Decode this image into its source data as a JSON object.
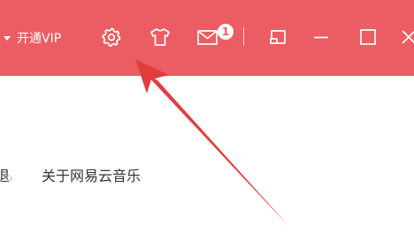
{
  "titlebar": {
    "background_color": "#ec5c63",
    "vip_label": "开通VIP",
    "icons": {
      "vip_dropdown": "caret-down-icon",
      "settings": "gear-icon",
      "skin": "tshirt-icon",
      "messages": "mail-icon",
      "mini_mode": "mini-player-icon",
      "minimize": "minimize-icon",
      "maximize": "maximize-icon",
      "close": "close-icon"
    },
    "message_count": "1"
  },
  "menu": {
    "left_item_label": "退出",
    "about_label": "关于网易云音乐"
  },
  "annotation": {
    "arrow_color": "#e23d3d",
    "arrow_target": "settings"
  }
}
